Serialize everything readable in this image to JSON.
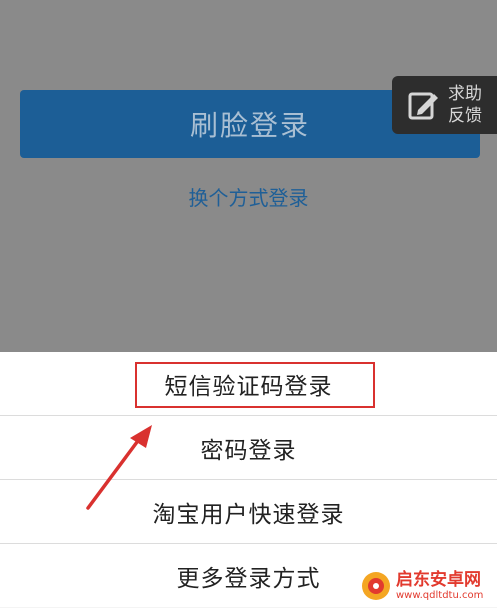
{
  "background": {
    "face_login_label": "刷脸登录",
    "switch_method_label": "换个方式登录",
    "help_line1": "求助",
    "help_line2": "反馈"
  },
  "sheet": {
    "options": [
      "短信验证码登录",
      "密码登录",
      "淘宝用户快速登录",
      "更多登录方式"
    ]
  },
  "watermark": {
    "line1": "启东安卓网",
    "line2": "www.qdltdtu.com"
  },
  "colors": {
    "accent": "#1c5e96",
    "highlight": "#d9312f"
  }
}
